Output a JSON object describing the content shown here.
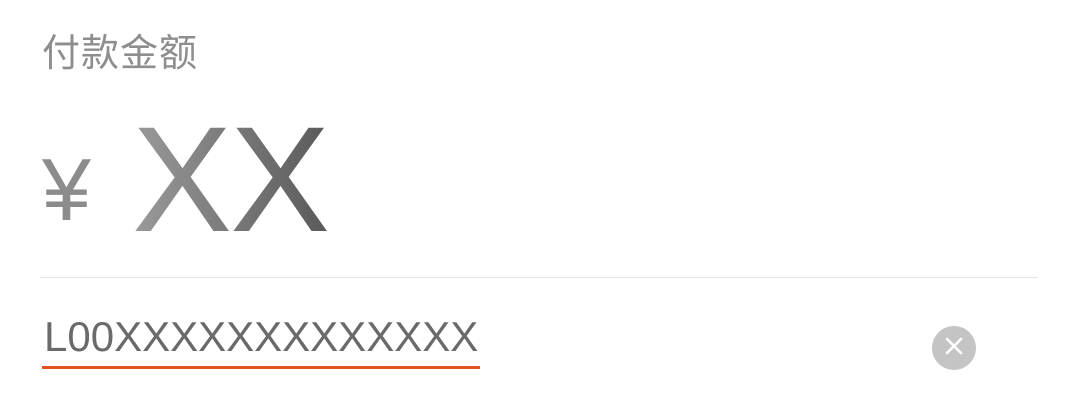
{
  "payment": {
    "label": "付款金额",
    "currency_symbol": "¥",
    "amount": "XX"
  },
  "account_field": {
    "value": "L00XXXXXXXXXXXXX",
    "underline_color": "#e2531f"
  },
  "icons": {
    "clear": "close-icon"
  }
}
